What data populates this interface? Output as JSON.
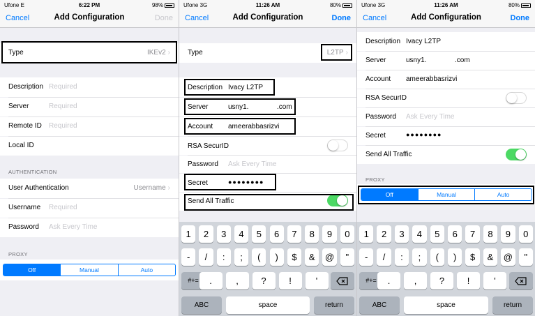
{
  "screens": [
    {
      "status": {
        "carrier": "Ufone  E",
        "time": "6:22 PM",
        "battery": "98%"
      },
      "nav": {
        "cancel": "Cancel",
        "title": "Add Configuration",
        "done": "Done"
      },
      "rows": {
        "type_label": "Type",
        "type_value": "IKEv2",
        "description_label": "Description",
        "description_placeholder": "Required",
        "server_label": "Server",
        "server_placeholder": "Required",
        "remote_id_label": "Remote ID",
        "remote_id_placeholder": "Required",
        "local_id_label": "Local ID",
        "auth_header": "AUTHENTICATION",
        "user_auth_label": "User Authentication",
        "user_auth_value": "Username",
        "username_label": "Username",
        "username_placeholder": "Required",
        "password_label": "Password",
        "password_placeholder": "Ask Every Time",
        "proxy_header": "PROXY"
      },
      "proxy_options": [
        "Off",
        "Manual",
        "Auto"
      ]
    },
    {
      "status": {
        "carrier": "Ufone  3G",
        "time": "11:26 AM",
        "battery": "80%"
      },
      "nav": {
        "cancel": "Cancel",
        "title": "Add Configuration",
        "done": "Done"
      },
      "rows": {
        "type_label": "Type",
        "type_value": "L2TP",
        "description_label": "Description",
        "description_value": "Ivacy L2TP",
        "server_label": "Server",
        "server_value": "usny1.",
        "server_suffix": ".com",
        "account_label": "Account",
        "account_value": "ameerabbasrizvi",
        "rsa_label": "RSA SecurID",
        "password_label": "Password",
        "password_placeholder": "Ask Every Time",
        "secret_label": "Secret",
        "secret_value": "●●●●●●●●",
        "send_all_label": "Send All Traffic"
      }
    },
    {
      "status": {
        "carrier": "Ufone  3G",
        "time": "11:26 AM",
        "battery": "80%"
      },
      "nav": {
        "cancel": "Cancel",
        "title": "Add Configuration",
        "done": "Done"
      },
      "rows": {
        "description_label": "Description",
        "description_value": "Ivacy L2TP",
        "server_label": "Server",
        "server_value": "usny1.",
        "server_suffix": ".com",
        "account_label": "Account",
        "account_value": "ameerabbasrizvi",
        "rsa_label": "RSA SecurID",
        "password_label": "Password",
        "password_placeholder": "Ask Every Time",
        "secret_label": "Secret",
        "secret_value": "●●●●●●●●",
        "send_all_label": "Send All Traffic",
        "proxy_header": "PROXY"
      },
      "proxy_options": [
        "Off",
        "Manual",
        "Auto"
      ]
    }
  ],
  "keyboard": {
    "row1": [
      "1",
      "2",
      "3",
      "4",
      "5",
      "6",
      "7",
      "8",
      "9",
      "0"
    ],
    "row2": [
      "-",
      "/",
      ":",
      ";",
      "(",
      ")",
      "$",
      "&",
      "@",
      "\""
    ],
    "row3": [
      ".",
      ",",
      "?",
      "!",
      "'"
    ],
    "shift": "#+=",
    "abc": "ABC",
    "space": "space",
    "return": "return",
    "delete_icon": "backspace-icon"
  },
  "colors": {
    "accent": "#007aff",
    "toggle_on": "#4cd964",
    "highlight": "#000000"
  }
}
